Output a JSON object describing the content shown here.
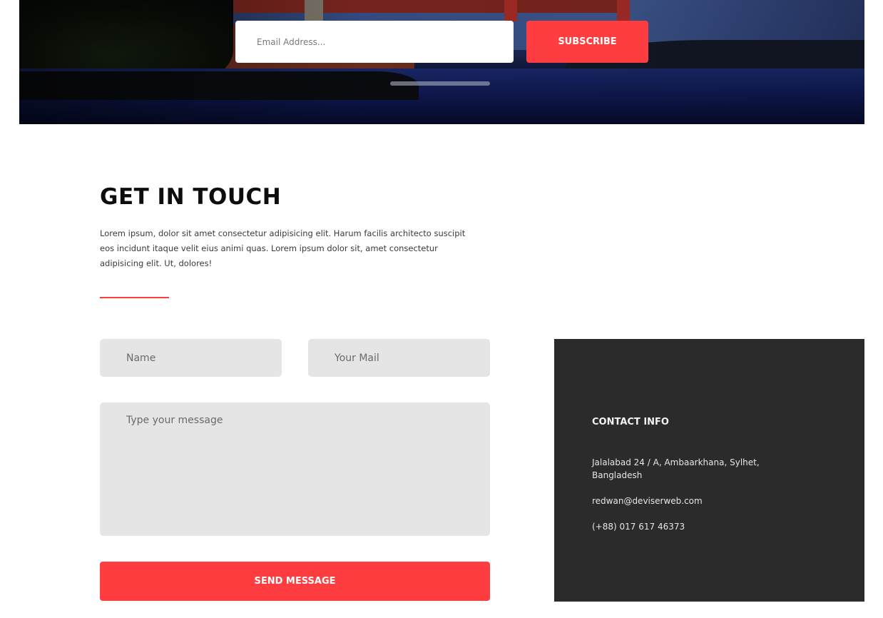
{
  "newsletter": {
    "email_placeholder": "Email Address...",
    "subscribe_label": "SUBSCRIBE"
  },
  "get_in_touch": {
    "title": "GET IN TOUCH",
    "description": "Lorem ipsum, dolor sit amet consectetur adipisicing elit. Harum facilis architecto suscipit eos incidunt itaque velit eius animi quas. Lorem ipsum dolor sit, amet consectetur adipisicing elit. Ut, dolores!"
  },
  "form": {
    "name_placeholder": "Name",
    "mail_placeholder": "Your Mail",
    "message_placeholder": "Type your message",
    "send_label": "SEND MESSAGE"
  },
  "contact_info": {
    "title": "CONTACT INFO",
    "address": "Jalalabad 24 / A, Ambaarkhana, Sylhet, Bangladesh",
    "email": "redwan@deviserweb.com",
    "phone": "(+88) 017 617 46373"
  },
  "colors": {
    "accent": "#fd3d40",
    "panel_dark": "#2b2b2b",
    "field_bg": "#e5e5e5"
  }
}
